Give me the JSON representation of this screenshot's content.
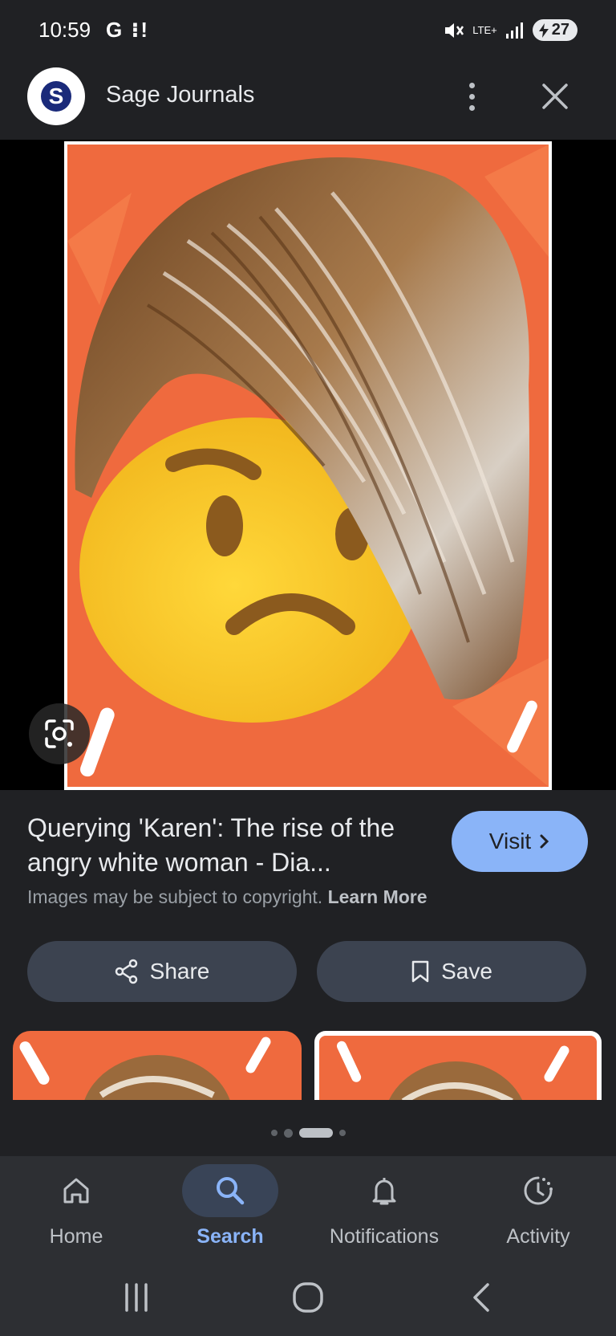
{
  "status_bar": {
    "time": "10:59",
    "left_icons": "G ⁝!",
    "network": "LTE+",
    "battery": "27"
  },
  "header": {
    "favicon_letter": "S",
    "site_name": "Sage Journals",
    "menu_icon": "more-vert-icon",
    "close_icon": "close-icon"
  },
  "result": {
    "title": "Querying 'Karen': The rise of the angry white woman - Dia...",
    "visit_label": "Visit",
    "copyright_text": "Images may be subject to copyright.",
    "learn_more": "Learn More",
    "share_label": "Share",
    "save_label": "Save"
  },
  "carousel": {
    "page_count": 4,
    "active_index": 2
  },
  "bottom_nav": {
    "items": [
      {
        "label": "Home",
        "icon": "home-icon"
      },
      {
        "label": "Search",
        "icon": "search-icon",
        "active": true
      },
      {
        "label": "Notifications",
        "icon": "bell-icon"
      },
      {
        "label": "Activity",
        "icon": "activity-icon"
      }
    ]
  },
  "colors": {
    "background": "#202124",
    "accent": "#8ab4f8",
    "button_bg": "#3c4350",
    "image_orange": "#ef6a3e",
    "emoji_yellow": "#f6c626"
  }
}
